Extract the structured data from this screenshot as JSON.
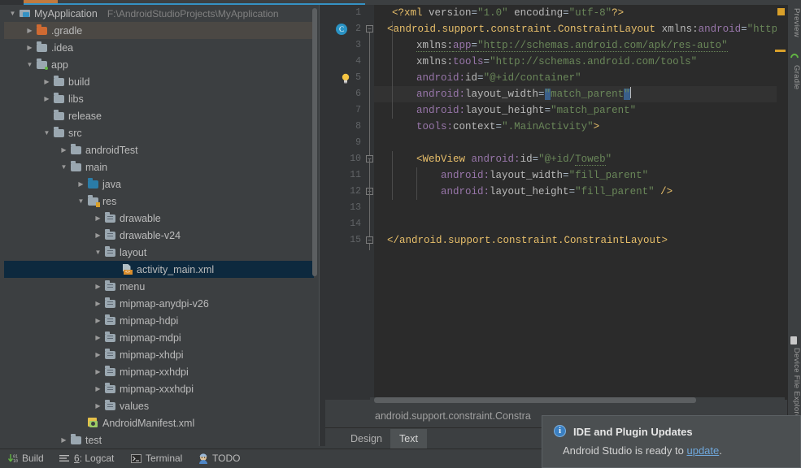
{
  "window": {
    "ide_name": "Android Studio"
  },
  "project_tree": {
    "title": "MyApplication",
    "path": "F:\\AndroidStudioProjects\\MyApplication",
    "items": [
      {
        "label": "MyApplication",
        "icon": "app-module-icon",
        "indent": 0,
        "arrow": "down",
        "state": "root"
      },
      {
        "label": ".gradle",
        "icon": "folder-orange-icon",
        "indent": 1,
        "arrow": "right",
        "state": "hover"
      },
      {
        "label": ".idea",
        "icon": "folder-icon",
        "indent": 1,
        "arrow": "right",
        "state": "normal"
      },
      {
        "label": "app",
        "icon": "folder-module-icon",
        "indent": 1,
        "arrow": "down",
        "state": "normal"
      },
      {
        "label": "build",
        "icon": "folder-icon",
        "indent": 2,
        "arrow": "right",
        "state": "normal"
      },
      {
        "label": "libs",
        "icon": "folder-icon",
        "indent": 2,
        "arrow": "right",
        "state": "normal"
      },
      {
        "label": "release",
        "icon": "folder-icon",
        "indent": 2,
        "arrow": "none",
        "state": "normal"
      },
      {
        "label": "src",
        "icon": "folder-icon",
        "indent": 2,
        "arrow": "down",
        "state": "normal"
      },
      {
        "label": "androidTest",
        "icon": "folder-icon",
        "indent": 3,
        "arrow": "right",
        "state": "normal"
      },
      {
        "label": "main",
        "icon": "folder-icon",
        "indent": 3,
        "arrow": "down",
        "state": "normal"
      },
      {
        "label": "java",
        "icon": "folder-source-icon",
        "indent": 4,
        "arrow": "right",
        "state": "normal"
      },
      {
        "label": "res",
        "icon": "folder-res-icon",
        "indent": 4,
        "arrow": "down",
        "state": "normal"
      },
      {
        "label": "drawable",
        "icon": "folder-resdir-icon",
        "indent": 5,
        "arrow": "right",
        "state": "normal"
      },
      {
        "label": "drawable-v24",
        "icon": "folder-resdir-icon",
        "indent": 5,
        "arrow": "right",
        "state": "normal"
      },
      {
        "label": "layout",
        "icon": "folder-resdir-icon",
        "indent": 5,
        "arrow": "down",
        "state": "normal"
      },
      {
        "label": "activity_main.xml",
        "icon": "layout-xml-icon",
        "indent": 6,
        "arrow": "none",
        "state": "selected"
      },
      {
        "label": "menu",
        "icon": "folder-resdir-icon",
        "indent": 5,
        "arrow": "right",
        "state": "normal"
      },
      {
        "label": "mipmap-anydpi-v26",
        "icon": "folder-resdir-icon",
        "indent": 5,
        "arrow": "right",
        "state": "normal"
      },
      {
        "label": "mipmap-hdpi",
        "icon": "folder-resdir-icon",
        "indent": 5,
        "arrow": "right",
        "state": "normal"
      },
      {
        "label": "mipmap-mdpi",
        "icon": "folder-resdir-icon",
        "indent": 5,
        "arrow": "right",
        "state": "normal"
      },
      {
        "label": "mipmap-xhdpi",
        "icon": "folder-resdir-icon",
        "indent": 5,
        "arrow": "right",
        "state": "normal"
      },
      {
        "label": "mipmap-xxhdpi",
        "icon": "folder-resdir-icon",
        "indent": 5,
        "arrow": "right",
        "state": "normal"
      },
      {
        "label": "mipmap-xxxhdpi",
        "icon": "folder-resdir-icon",
        "indent": 5,
        "arrow": "right",
        "state": "normal"
      },
      {
        "label": "values",
        "icon": "folder-resdir-icon",
        "indent": 5,
        "arrow": "right",
        "state": "normal"
      },
      {
        "label": "AndroidManifest.xml",
        "icon": "manifest-icon",
        "indent": 4,
        "arrow": "none",
        "state": "normal"
      },
      {
        "label": "test",
        "icon": "folder-icon",
        "indent": 3,
        "arrow": "right",
        "state": "normal"
      }
    ]
  },
  "editor": {
    "file": "activity_main.xml",
    "breadcrumb": "android.support.constraint.Constra",
    "line_numbers": [
      "1",
      "2",
      "3",
      "4",
      "5",
      "6",
      "7",
      "8",
      "9",
      "10",
      "11",
      "12",
      "13",
      "14",
      "15"
    ],
    "lines": [
      "<?xml version=\"1.0\" encoding=\"utf-8\"?>",
      "<android.support.constraint.ConstraintLayout xmlns:android=\"http://schemas.android.com",
      "    xmlns:app=\"http://schemas.android.com/apk/res-auto\"",
      "    xmlns:tools=\"http://schemas.android.com/tools\"",
      "    android:id=\"@+id/container\"",
      "    android:layout_width=\"match_parent\"",
      "    android:layout_height=\"match_parent\"",
      "    tools:context=\".MainActivity\">",
      "",
      "    <WebView android:id=\"@+id/Toweb\"",
      "        android:layout_width=\"fill_parent\"",
      "        android:layout_height=\"fill_parent\" />",
      "",
      "",
      "</android.support.constraint.ConstraintLayout>"
    ],
    "current_line": 6,
    "gutter_icons": [
      {
        "line": 2,
        "icon": "class-marker-icon",
        "glyph": "C"
      },
      {
        "line": 5,
        "icon": "intention-bulb-icon"
      }
    ],
    "tabs": [
      {
        "label": "Design",
        "selected": false
      },
      {
        "label": "Text",
        "selected": true
      }
    ]
  },
  "right_rail": {
    "items": [
      {
        "label": "Preview",
        "icon": "preview-icon"
      },
      {
        "label": "Gradle",
        "icon": "gradle-icon"
      },
      {
        "label": "Device File Explorer",
        "icon": "device-file-explorer-icon"
      }
    ]
  },
  "status_bar": {
    "items": [
      {
        "label": "Build",
        "icon": "build-icon",
        "prefix": ""
      },
      {
        "label": ": Logcat",
        "icon": "logcat-icon",
        "prefix": "6"
      },
      {
        "label": "Terminal",
        "icon": "terminal-icon",
        "prefix": ""
      },
      {
        "label": "TODO",
        "icon": "todo-icon",
        "prefix": ""
      }
    ]
  },
  "notification": {
    "title": "IDE and Plugin Updates",
    "body_before": "Android Studio is ready to ",
    "link": "update",
    "body_after": ".",
    "icon": "info-icon"
  },
  "colors": {
    "background": "#3c3f41",
    "editor_bg": "#2b2b2b",
    "selection": "#0d293e",
    "accent": "#3592c4",
    "link": "#6fa8dc",
    "string": "#6a8759",
    "tag": "#e8bf6a",
    "namespace": "#9876aa"
  }
}
